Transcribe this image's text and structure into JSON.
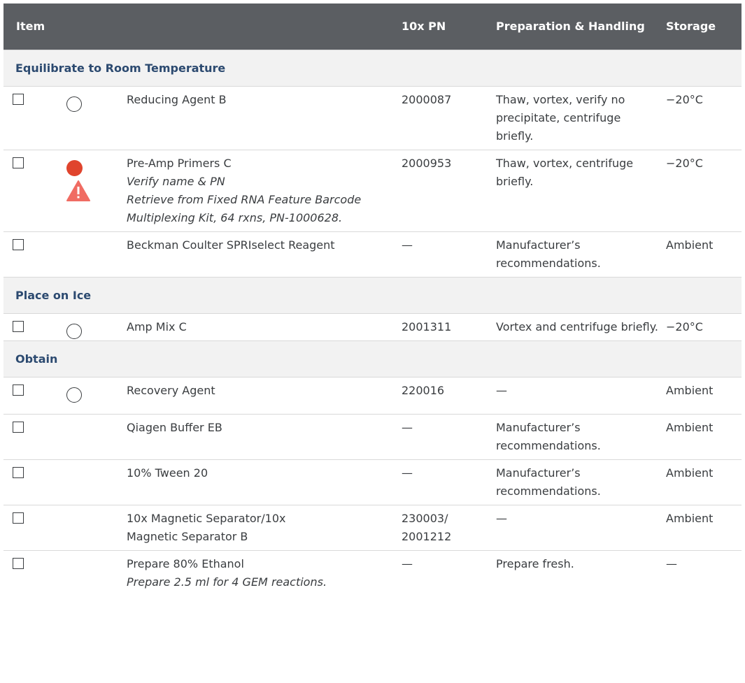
{
  "header": {
    "item": "Item",
    "pn": "10x PN",
    "prep": "Preparation & Handling",
    "storage": "Storage"
  },
  "sections": [
    {
      "title": "Equilibrate to Room Temperature",
      "rows": [
        {
          "name": "Reducing Agent B",
          "pn": "2000087",
          "prep": "Thaw, vortex, verify no precipitate, centrifuge briefly.",
          "storage": "−20°C",
          "marker": "circle-icon"
        },
        {
          "name": "Pre-Amp Primers C",
          "note1": "Verify name & PN",
          "note2": "Retrieve from Fixed RNA Feature Barcode Multiplexing Kit, 64 rxns, PN-1000628.",
          "pn": "2000953",
          "prep": "Thaw, vortex, centrifuge briefly.",
          "storage": "−20°C",
          "marker": "red-dot-icon",
          "warning": "warning-icon",
          "warning_color": "#f06c63"
        },
        {
          "name": "Beckman Coulter SPRIselect Reagent",
          "pn": "—",
          "prep": "Manufacturer’s recommendations.",
          "storage": "Ambient"
        }
      ]
    },
    {
      "title": "Place on Ice",
      "rows": [
        {
          "name": "Amp Mix C",
          "pn": "2001311",
          "prep": "Vortex and centrifuge briefly.",
          "storage": "−20°C",
          "marker": "circle-icon"
        }
      ]
    },
    {
      "title": "Obtain",
      "rows": [
        {
          "name": "Recovery Agent",
          "pn": "220016",
          "prep": "—",
          "storage": "Ambient",
          "marker": "circle-icon"
        },
        {
          "name": "Qiagen Buffer EB",
          "pn": "—",
          "prep": "Manufacturer’s recommendations.",
          "storage": "Ambient"
        },
        {
          "name": "10% Tween 20",
          "pn": "—",
          "prep": "Manufacturer’s recommendations.",
          "storage": "Ambient"
        },
        {
          "name": "10x Magnetic Separator/10x Magnetic Separator B",
          "pn": "230003/ 2001212",
          "prep": "—",
          "storage": "Ambient"
        },
        {
          "name": "Prepare 80% Ethanol",
          "note1": "Prepare 2.5 ml for 4 GEM reactions.",
          "pn": "—",
          "prep": "Prepare fresh.",
          "storage": "—"
        }
      ]
    }
  ],
  "colors": {
    "header_bg": "#5b5e62",
    "section_bg": "#f2f2f2",
    "section_text": "#2c4a70",
    "red_dot": "#e0442d",
    "warning": "#f06c63"
  }
}
